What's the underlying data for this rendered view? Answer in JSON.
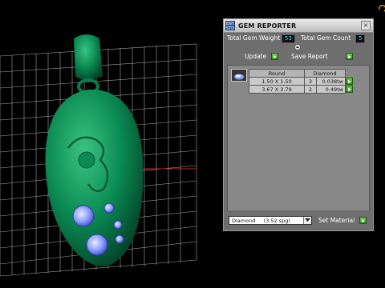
{
  "window": {
    "title": "GEM REPORTER",
    "logo_text": "ENT STD",
    "close_glyph": "×"
  },
  "stats": {
    "weight_label": "Total Gem Weight",
    "weight_value": "53",
    "count_label": "Total Gem Count",
    "count_value": "5"
  },
  "actions": {
    "update_label": "Update",
    "save_label": "Save Report"
  },
  "table": {
    "headers": [
      "Round",
      "Diamond"
    ],
    "rows": [
      {
        "size": "1.50 X 1.50",
        "count": "3",
        "weight": "0.038tw"
      },
      {
        "size": "3.67 X 3.79",
        "count": "2",
        "weight": "0.49tw"
      }
    ]
  },
  "material": {
    "selected": "Diamond     (3.52 spg)",
    "set_label": "Set Material"
  },
  "icons": {
    "collapse": "collapse-arrow-icon",
    "gem_thumb": "gem-thumbnail-icon",
    "green_arrow": "green-arrow-icon"
  },
  "colors": {
    "pendant": "#0a7a4a",
    "grid": "#bfbfbf",
    "axis": "#cc2222",
    "value_text": "#3fd3ff"
  }
}
